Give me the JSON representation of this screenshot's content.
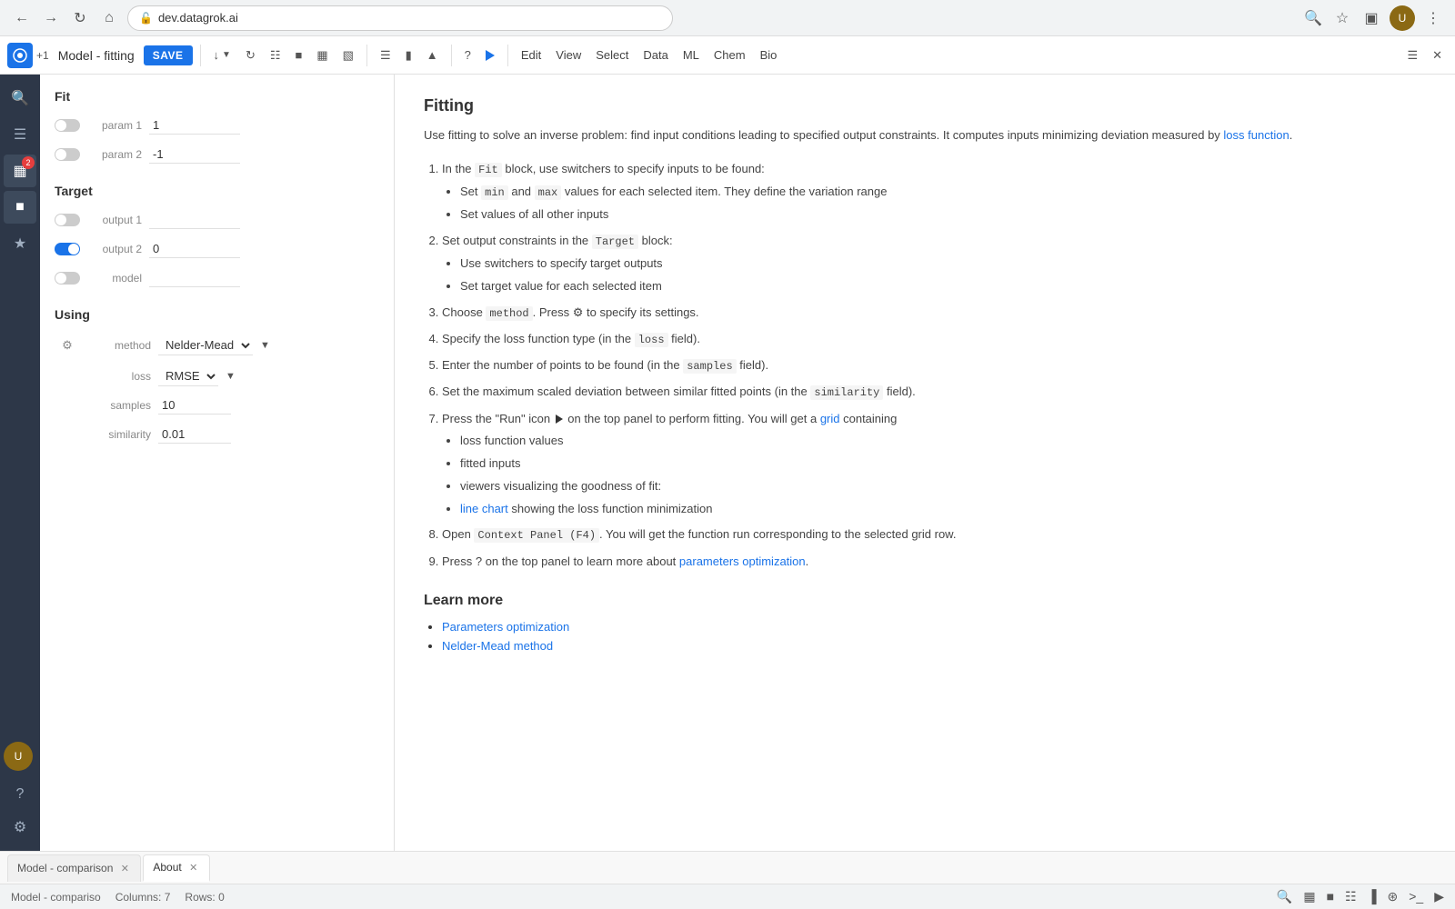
{
  "browser": {
    "url": "dev.datagrok.ai"
  },
  "toolbar": {
    "plus_label": "+1",
    "title": "Model - fitting",
    "save_label": "SAVE",
    "menu_items": [
      "Edit",
      "View",
      "Select",
      "Data",
      "ML",
      "Chem",
      "Bio"
    ]
  },
  "left_panel": {
    "fit_section": "Fit",
    "params": [
      {
        "label": "param 1",
        "value": "1",
        "active": false
      },
      {
        "label": "param 2",
        "value": "-1",
        "active": false
      }
    ],
    "target_section": "Target",
    "targets": [
      {
        "label": "output 1",
        "value": "",
        "active": false
      },
      {
        "label": "output 2",
        "value": "0",
        "active": true
      },
      {
        "label": "model",
        "value": "",
        "active": false
      }
    ],
    "using_section": "Using",
    "method_label": "method",
    "method_value": "Nelder-Mead",
    "loss_label": "loss",
    "loss_value": "RMSE",
    "samples_label": "samples",
    "samples_value": "10",
    "similarity_label": "similarity",
    "similarity_value": "0.01"
  },
  "content": {
    "fitting_title": "Fitting",
    "fitting_desc": "Use fitting to solve an inverse problem: find input conditions leading to specified output constraints. It computes inputs minimizing deviation measured by ",
    "loss_function_link": "loss function",
    "steps": [
      {
        "text": "In the ",
        "code1": "Fit",
        "text2": " block, use switchers to specify inputs to be found:",
        "sub": [
          "Set min and max values for each selected item. They define the variation range",
          "Set values of all other inputs"
        ]
      },
      {
        "text": "Set output constraints in the ",
        "code1": "Target",
        "text2": " block:",
        "sub": [
          "Use switchers to specify target outputs",
          "Set target value for each selected item"
        ]
      },
      {
        "text": "Choose method. Press ⚙ to specify its settings."
      },
      {
        "text": "Specify the loss function type (in the ",
        "code1": "loss",
        "text2": " field)."
      },
      {
        "text": "Enter the number of points to be found (in the ",
        "code1": "samples",
        "text2": " field)."
      },
      {
        "text": "Set the maximum scaled deviation between similar fitted points (in the ",
        "code1": "similarity",
        "text2": " field)."
      },
      {
        "text": "Press the \"Run\" icon ▶ on the top panel to perform fitting. You will get a ",
        "grid_link": "grid",
        "text2": " containing",
        "sub": [
          "loss function values",
          "fitted inputs",
          "viewers visualizing the goodness of fit:",
          "line chart showing the loss function minimization"
        ]
      },
      {
        "text": "Open ",
        "code1": "Context Panel (F4)",
        "text2": ". You will get the function run corresponding to the selected grid row."
      },
      {
        "text": "Press ? on the top panel to learn more about ",
        "params_link": "parameters optimization",
        "text2": "."
      }
    ],
    "learn_more_title": "Learn more",
    "learn_links": [
      "Parameters optimization",
      "Nelder-Mead method"
    ]
  },
  "bottom_tabs": [
    {
      "label": "Model - comparison",
      "active": false,
      "closable": true
    },
    {
      "label": "About",
      "active": true,
      "closable": true
    }
  ],
  "status_bar": {
    "model_text": "Model - compariso",
    "columns": "Columns: 7",
    "rows": "Rows: 0"
  }
}
